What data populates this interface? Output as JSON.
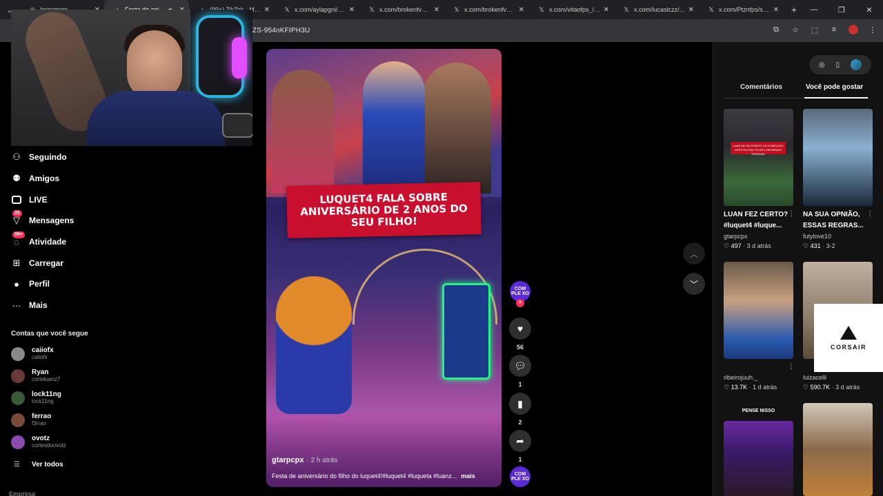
{
  "browser": {
    "tabs": [
      {
        "title": "Instagram",
        "icon": "instagram-icon",
        "active": false
      },
      {
        "title": "Festa de aniversá...",
        "icon": "tiktok-icon",
        "active": true,
        "muted_icon": "speaker-icon"
      },
      {
        "title": "(99+) TikTok - Make Y",
        "icon": "tiktok-icon",
        "active": false
      },
      {
        "title": "x.com/aylapgni/statu",
        "icon": "x-icon",
        "active": false
      },
      {
        "title": "x.com/brokenfvm/stat",
        "icon": "x-icon",
        "active": false
      },
      {
        "title": "x.com/brokenfvm/stat",
        "icon": "x-icon",
        "active": false
      },
      {
        "title": "x.com/vitaofps_/statu",
        "icon": "x-icon",
        "active": false
      },
      {
        "title": "x.com/lucaslczz/statu",
        "icon": "x-icon",
        "active": false
      },
      {
        "title": "x.com/Ptznfps/statu",
        "icon": "x-icon",
        "active": false
      }
    ],
    "url_visible": "ZS-954nKFIPH3U"
  },
  "sidebar": {
    "items": [
      {
        "label": "Seguindo",
        "icon": "following-icon"
      },
      {
        "label": "Amigos",
        "icon": "friends-icon"
      },
      {
        "label": "LIVE",
        "icon": "live-icon"
      },
      {
        "label": "Mensagens",
        "icon": "messages-icon",
        "badge": "20"
      },
      {
        "label": "Atividade",
        "icon": "activity-icon",
        "badge": "99+"
      },
      {
        "label": "Carregar",
        "icon": "upload-icon"
      },
      {
        "label": "Perfil",
        "icon": "profile-icon"
      },
      {
        "label": "Mais",
        "icon": "more-icon"
      }
    ],
    "following_title": "Contas que você segue",
    "accounts": [
      {
        "name": "caiiofx",
        "handle": "caiiofx",
        "color": "#8a8a8a"
      },
      {
        "name": "Ryan",
        "handle": "corteluanz7",
        "color": "#6a3a3a"
      },
      {
        "name": "lock11ng",
        "handle": "lock11ng",
        "color": "#3a5a3a"
      },
      {
        "name": "ferrao",
        "handle": "f3rrao",
        "color": "#7a4a3a"
      },
      {
        "name": "ovotz",
        "handle": "cortesdoovotz",
        "color": "#8a4ab0"
      }
    ],
    "see_all": "Ver todos",
    "footer": "Empresa"
  },
  "video": {
    "banner": "LUQUET4 FALA SOBRE ANIVERSÁRIO DE 2 ANOS DO SEU FILHO!",
    "author": "gtarpcpx",
    "time": "· 2 h atrás",
    "caption": "Festa de aniversário do filho do luquet4!#luquet4 #luqueta #luanz...",
    "more": "mais"
  },
  "actions": {
    "creator_avatar_text": "COM PLE XO",
    "likes": "56",
    "comments": "1",
    "saves": "2",
    "shares": "1",
    "music_text": "COM PLE XO"
  },
  "right_panel": {
    "tabs": [
      "Comentários",
      "Você pode gostar"
    ],
    "cards": [
      {
        "title": "LUAN FEZ CERTO? #luquet4 #luque...",
        "user": "gtarpcpx",
        "likes": "497",
        "time": "· 3 d atrás",
        "thumb_text": "LUAN SAI DE EVENTO DO COMPLEXO APÓS ELA FAC FICAR COM MENOS PESSOAS"
      },
      {
        "title": "NA SUA OPNIÃO, ESSAS REGRAS...",
        "user": "futylove10",
        "likes": "431",
        "time": "· 3-2"
      },
      {
        "title": "",
        "user": "ribeirojuuh._",
        "likes": "13.7K",
        "time": "· 1 d atrás"
      },
      {
        "title": "",
        "user": "luizacelli",
        "likes": "590.7K",
        "time": "· 3 d atrás"
      }
    ],
    "pense_label": "PENSE NISSO"
  },
  "overlay": {
    "brand": "CORSAIR"
  }
}
